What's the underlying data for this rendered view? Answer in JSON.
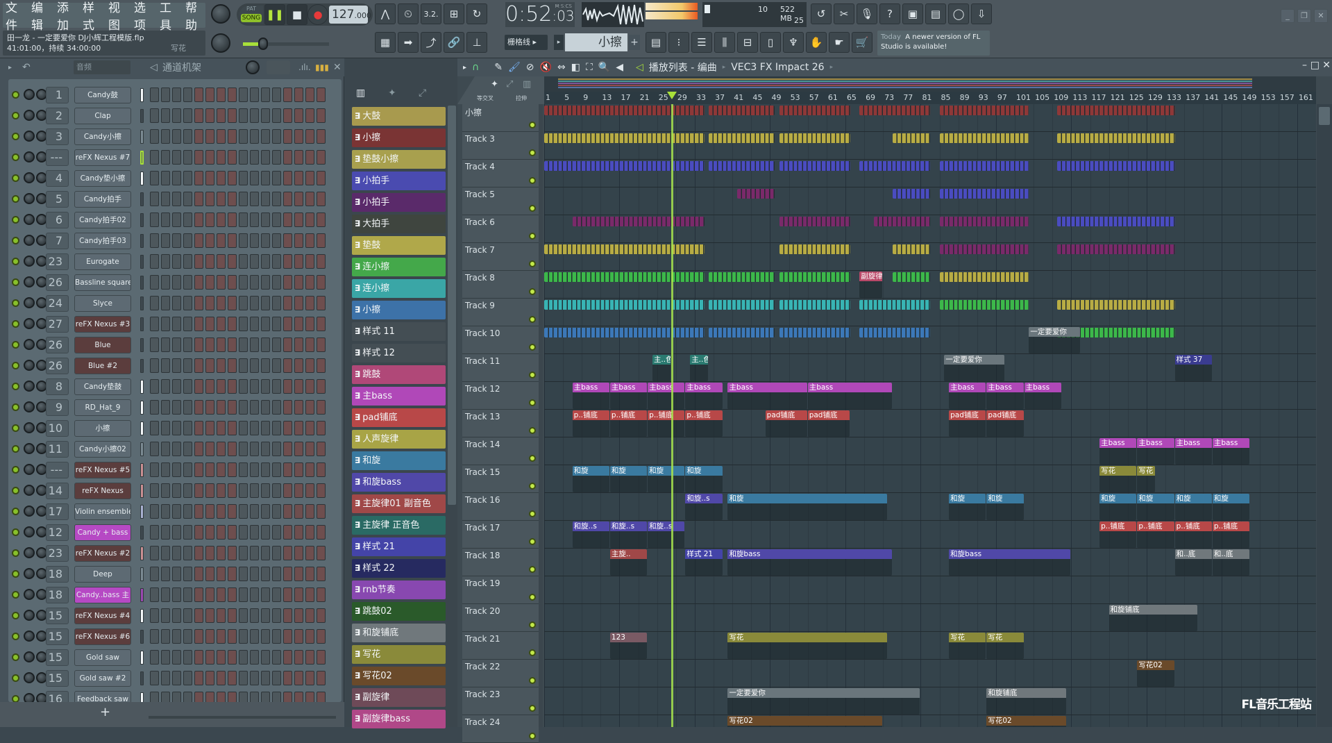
{
  "menu": [
    "文件",
    "编辑",
    "添加",
    "样式",
    "视图",
    "选项",
    "工具",
    "帮助"
  ],
  "song": {
    "file": "田一龙 - 一定要爱你 DJ小辉工程模版.flp",
    "time": "41:01:00，持续 34:00:00",
    "hint": "写花"
  },
  "transport": {
    "mode_top": "PAT",
    "mode": "SONG",
    "tempo": "127",
    "tempo_dec": ".000",
    "clock_main": "0:52",
    "clock_cs": ":03",
    "clock_unit": "M:S:CS"
  },
  "cpu": {
    "value": "10",
    "memory": "522 MB",
    "polyphony": "25"
  },
  "snap": "栅格线",
  "current_pattern": "小擦",
  "news": {
    "today": "Today",
    "text": "A newer version of FL Studio is available!"
  },
  "rack": {
    "filter": "音频",
    "title": "通道机架",
    "add": "+",
    "channels": [
      {
        "num": "1",
        "name": "Candy鼓",
        "style": "",
        "bar": "white"
      },
      {
        "num": "2",
        "name": "Clap",
        "style": "",
        "bar": ""
      },
      {
        "num": "3",
        "name": "Candy小擦",
        "style": "",
        "bar": "grey",
        "steps": [
          3,
          7,
          11,
          15
        ]
      },
      {
        "num": "---",
        "name": "reFX Nexus #7",
        "style": "",
        "bar": "green"
      },
      {
        "num": "4",
        "name": "Candy垫小擦",
        "style": "",
        "bar": "white"
      },
      {
        "num": "5",
        "name": "Candy拍手",
        "style": "",
        "bar": ""
      },
      {
        "num": "6",
        "name": "Candy拍手02",
        "style": "",
        "bar": ""
      },
      {
        "num": "7",
        "name": "Candy拍手03",
        "style": "",
        "bar": ""
      },
      {
        "num": "23",
        "name": "Eurogate",
        "style": "",
        "bar": ""
      },
      {
        "num": "26",
        "name": "Bassline square",
        "style": "",
        "bar": ""
      },
      {
        "num": "24",
        "name": "Slyce",
        "style": "",
        "bar": ""
      },
      {
        "num": "27",
        "name": "reFX Nexus #3",
        "style": "red",
        "bar": ""
      },
      {
        "num": "26",
        "name": "Blue",
        "style": "red",
        "bar": ""
      },
      {
        "num": "26",
        "name": "Blue #2",
        "style": "red",
        "bar": ""
      },
      {
        "num": "8",
        "name": "Candy垫鼓",
        "style": "",
        "bar": "white"
      },
      {
        "num": "9",
        "name": "RD_Hat_9",
        "style": "",
        "bar": "white"
      },
      {
        "num": "10",
        "name": "小擦",
        "style": "",
        "bar": "white"
      },
      {
        "num": "11",
        "name": "Candy小擦02",
        "style": "",
        "bar": "grey"
      },
      {
        "num": "---",
        "name": "reFX Nexus #5",
        "style": "red",
        "bar": "pink"
      },
      {
        "num": "14",
        "name": "reFX Nexus",
        "style": "red",
        "bar": "pink"
      },
      {
        "num": "17",
        "name": "Violin ensemble",
        "style": "",
        "bar": "lav"
      },
      {
        "num": "12",
        "name": "Candy  + bass",
        "style": "purple",
        "bar": ""
      },
      {
        "num": "23",
        "name": "reFX Nexus #2",
        "style": "red",
        "bar": "pink"
      },
      {
        "num": "18",
        "name": "Deep",
        "style": "",
        "bar": "grey"
      },
      {
        "num": "18",
        "name": "Candy..bass 主",
        "style": "purple",
        "bar": "purple"
      },
      {
        "num": "15",
        "name": "reFX Nexus #4",
        "style": "red",
        "bar": "white"
      },
      {
        "num": "15",
        "name": "reFX Nexus #6",
        "style": "red",
        "bar": ""
      },
      {
        "num": "15",
        "name": "Gold saw",
        "style": "",
        "bar": "white"
      },
      {
        "num": "15",
        "name": "Gold saw #2",
        "style": "",
        "bar": ""
      },
      {
        "num": "16",
        "name": "Feedback saw",
        "style": "",
        "bar": "white"
      }
    ]
  },
  "playlist": {
    "title": "播放列表 - 编曲",
    "crumb": "VEC3 FX Impact 26",
    "first_track": "小擦",
    "ruler": [
      "1",
      "5",
      "9",
      "13",
      "17",
      "21",
      "25",
      "29",
      "33",
      "37",
      "41",
      "45",
      "49",
      "53",
      "57",
      "61",
      "65",
      "69",
      "73",
      "77",
      "81",
      "85",
      "89",
      "93",
      "97",
      "101",
      "105",
      "109",
      "113",
      "117",
      "121",
      "125",
      "129",
      "133",
      "137",
      "141",
      "145",
      "149",
      "153",
      "157",
      "161"
    ],
    "header_labels": {
      "crossfade": "等交叉",
      "stretch": "拉伸"
    },
    "tracks": [
      "小擦",
      "Track 3",
      "Track 4",
      "Track 5",
      "Track 6",
      "Track 7",
      "Track 8",
      "Track 9",
      "Track 10",
      "Track 11",
      "Track 12",
      "Track 13",
      "Track 14",
      "Track 15",
      "Track 16",
      "Track 17",
      "Track 18",
      "Track 19",
      "Track 20",
      "Track 21",
      "Track 22",
      "Track 23",
      "Track 24"
    ],
    "patterns": [
      {
        "name": "大鼓",
        "color": "#a89a4e"
      },
      {
        "name": "小擦",
        "color": "#7a3434"
      },
      {
        "name": "垫鼓小擦",
        "color": "#a8a04e"
      },
      {
        "name": "小拍手",
        "color": "#4a4bb0"
      },
      {
        "name": "小拍手",
        "color": "#5a2a6a"
      },
      {
        "name": "大拍手",
        "color": "#3f453f"
      },
      {
        "name": "垫鼓",
        "color": "#b0a84a"
      },
      {
        "name": "连小擦",
        "color": "#44a84a"
      },
      {
        "name": "连小擦",
        "color": "#3aa6a6"
      },
      {
        "name": "小擦",
        "color": "#3d72a8"
      },
      {
        "name": "样式 11",
        "color": "#444e54"
      },
      {
        "name": "样式 12",
        "color": "#444e54"
      },
      {
        "name": "跳鼓",
        "color": "#b04878"
      },
      {
        "name": "主bass",
        "color": "#b048b8"
      },
      {
        "name": "pad铺底",
        "color": "#b84848"
      },
      {
        "name": "人声旋律",
        "color": "#a8a446"
      },
      {
        "name": "和旋",
        "color": "#3a7aa0"
      },
      {
        "name": "和旋bass",
        "color": "#5048a8"
      },
      {
        "name": "主旋律01  副音色",
        "color": "#a04848"
      },
      {
        "name": "主旋律 正音色",
        "color": "#2a6a64"
      },
      {
        "name": "样式 21",
        "color": "#4444a8"
      },
      {
        "name": "样式 22",
        "color": "#262a60"
      },
      {
        "name": "rnb节奏",
        "color": "#8848b0"
      },
      {
        "name": "跳鼓02",
        "color": "#2a5a2a"
      },
      {
        "name": "和旋铺底",
        "color": "#70787c"
      },
      {
        "name": "写花",
        "color": "#8a8a3a"
      },
      {
        "name": "写花02",
        "color": "#6a4a2a"
      },
      {
        "name": "副旋律",
        "color": "#6e4a58"
      },
      {
        "name": "副旋律bass",
        "color": "#b04888"
      }
    ],
    "lanes": [
      {
        "blocks": [
          [
            0,
            34,
            "#8e3838"
          ],
          [
            35,
            49,
            "#8e3838"
          ],
          [
            50,
            65,
            "#8e3838"
          ],
          [
            67,
            82,
            "#8e3838"
          ],
          [
            84,
            103,
            "#8e3838"
          ],
          [
            109,
            134,
            "#8e3838"
          ]
        ]
      },
      {
        "blocks": [
          [
            0,
            34,
            "#b8ac44"
          ],
          [
            35,
            49,
            "#b8ac44"
          ],
          [
            50,
            65,
            "#b8ac44"
          ],
          [
            74,
            82,
            "#b8ac44"
          ],
          [
            84,
            103,
            "#b8ac44"
          ],
          [
            109,
            134,
            "#b8ac44"
          ]
        ]
      },
      {
        "blocks": [
          [
            0,
            34,
            "#4a4cc0"
          ],
          [
            35,
            49,
            "#4a4cc0"
          ],
          [
            50,
            65,
            "#4a4cc0"
          ],
          [
            67,
            82,
            "#4a4cc0"
          ],
          [
            84,
            103,
            "#4a4cc0"
          ],
          [
            109,
            134,
            "#4a4cc0"
          ]
        ]
      },
      {
        "blocks": [
          [
            41,
            49,
            "#7a2a6a"
          ],
          [
            74,
            82,
            "#4a4cc0"
          ],
          [
            84,
            103,
            "#4a4cc0"
          ]
        ]
      },
      {
        "blocks": [
          [
            6,
            34,
            "#7a2a6a"
          ],
          [
            50,
            65,
            "#7a2a6a"
          ],
          [
            70,
            82,
            "#7a2a6a"
          ],
          [
            84,
            103,
            "#7a2a6a"
          ],
          [
            109,
            134,
            "#4a4cc0"
          ]
        ]
      },
      {
        "blocks": [
          [
            0,
            34,
            "#b8ac44"
          ],
          [
            50,
            65,
            "#b8ac44"
          ],
          [
            74,
            82,
            "#b8ac44"
          ],
          [
            84,
            103,
            "#7a2a6a"
          ],
          [
            109,
            134,
            "#7a2a6a"
          ]
        ]
      },
      {
        "blocks": [
          [
            0,
            34,
            "#3cb84a"
          ],
          [
            35,
            49,
            "#3cb84a"
          ],
          [
            50,
            65,
            "#3cb84a"
          ],
          [
            74,
            82,
            "#3cb84a"
          ],
          [
            84,
            103,
            "#b8ac44"
          ]
        ]
      },
      {
        "blocks": [
          [
            0,
            34,
            "#38b4b4"
          ],
          [
            35,
            49,
            "#38b4b4"
          ],
          [
            50,
            65,
            "#38b4b4"
          ],
          [
            67,
            82,
            "#38b4b4"
          ],
          [
            84,
            103,
            "#3cb84a"
          ],
          [
            109,
            134,
            "#b8ac44"
          ]
        ]
      },
      {
        "blocks": [
          [
            0,
            34,
            "#3c78b8"
          ],
          [
            35,
            49,
            "#3c78b8"
          ],
          [
            50,
            65,
            "#3c78b8"
          ],
          [
            67,
            82,
            "#3c78b8"
          ],
          [
            109,
            134,
            "#3cb84a"
          ]
        ]
      }
    ],
    "clips": [
      {
        "lane": 6,
        "start": 67,
        "len": 5,
        "label": "副旋律",
        "color": "#b84868"
      },
      {
        "lane": 9,
        "start": 23,
        "len": 4,
        "label": "主..色",
        "color": "#2a7a70"
      },
      {
        "lane": 9,
        "start": 31,
        "len": 4,
        "label": "主..色",
        "color": "#2a7a70"
      },
      {
        "lane": 9,
        "start": 85,
        "len": 13,
        "label": "一定要爱你",
        "color": "#6a767c"
      },
      {
        "lane": 8,
        "start": 103,
        "len": 11,
        "label": "一定要爱你",
        "color": "#6a767c"
      },
      {
        "lane": 9,
        "start": 134,
        "len": 8,
        "label": "样式 37",
        "color": "#3a3c90"
      },
      {
        "lane": 10,
        "start": 6,
        "len": 8,
        "label": "主bass",
        "color": "#b048b8"
      },
      {
        "lane": 10,
        "start": 14,
        "len": 8,
        "label": "主bass",
        "color": "#b048b8"
      },
      {
        "lane": 10,
        "start": 22,
        "len": 8,
        "label": "主bass",
        "color": "#b048b8"
      },
      {
        "lane": 10,
        "start": 30,
        "len": 8,
        "label": "主bass",
        "color": "#b048b8"
      },
      {
        "lane": 10,
        "start": 39,
        "len": 17,
        "label": "主bass",
        "color": "#b048b8"
      },
      {
        "lane": 10,
        "start": 56,
        "len": 18,
        "label": "主bass",
        "color": "#b048b8"
      },
      {
        "lane": 10,
        "start": 86,
        "len": 8,
        "label": "主bass",
        "color": "#b048b8"
      },
      {
        "lane": 10,
        "start": 94,
        "len": 8,
        "label": "主bass",
        "color": "#b048b8"
      },
      {
        "lane": 10,
        "start": 102,
        "len": 8,
        "label": "主bass",
        "color": "#b048b8"
      },
      {
        "lane": 11,
        "start": 6,
        "len": 8,
        "label": "p..铺底",
        "color": "#b84848"
      },
      {
        "lane": 11,
        "start": 14,
        "len": 8,
        "label": "p..铺底",
        "color": "#b84848"
      },
      {
        "lane": 11,
        "start": 22,
        "len": 8,
        "label": "p..铺底",
        "color": "#b84848"
      },
      {
        "lane": 11,
        "start": 30,
        "len": 8,
        "label": "p..铺底",
        "color": "#b84848"
      },
      {
        "lane": 11,
        "start": 47,
        "len": 9,
        "label": "pad铺底",
        "color": "#b84848"
      },
      {
        "lane": 11,
        "start": 56,
        "len": 9,
        "label": "pad铺底",
        "color": "#b84848"
      },
      {
        "lane": 11,
        "start": 86,
        "len": 8,
        "label": "pad铺底",
        "color": "#b84848"
      },
      {
        "lane": 11,
        "start": 94,
        "len": 8,
        "label": "pad铺底",
        "color": "#b84848"
      },
      {
        "lane": 12,
        "start": 118,
        "len": 8,
        "label": "主bass",
        "color": "#b048b8"
      },
      {
        "lane": 12,
        "start": 126,
        "len": 8,
        "label": "主bass",
        "color": "#b048b8"
      },
      {
        "lane": 12,
        "start": 134,
        "len": 8,
        "label": "主bass",
        "color": "#b048b8"
      },
      {
        "lane": 12,
        "start": 142,
        "len": 8,
        "label": "主bass",
        "color": "#b048b8"
      },
      {
        "lane": 13,
        "start": 6,
        "len": 8,
        "label": "和旋",
        "color": "#3a7aa0"
      },
      {
        "lane": 13,
        "start": 14,
        "len": 8,
        "label": "和旋",
        "color": "#3a7aa0"
      },
      {
        "lane": 13,
        "start": 22,
        "len": 8,
        "label": "和旋",
        "color": "#3a7aa0"
      },
      {
        "lane": 13,
        "start": 30,
        "len": 8,
        "label": "和旋",
        "color": "#3a7aa0"
      },
      {
        "lane": 13,
        "start": 118,
        "len": 8,
        "label": "写花",
        "color": "#8a8a3a"
      },
      {
        "lane": 13,
        "start": 126,
        "len": 4,
        "label": "写花",
        "color": "#8a8a3a"
      },
      {
        "lane": 14,
        "start": 30,
        "len": 8,
        "label": "和旋..s",
        "color": "#5048a8"
      },
      {
        "lane": 14,
        "start": 39,
        "len": 34,
        "label": "和旋",
        "color": "#3a7aa0"
      },
      {
        "lane": 14,
        "start": 86,
        "len": 8,
        "label": "和旋",
        "color": "#3a7aa0"
      },
      {
        "lane": 14,
        "start": 94,
        "len": 8,
        "label": "和旋",
        "color": "#3a7aa0"
      },
      {
        "lane": 14,
        "start": 118,
        "len": 8,
        "label": "和旋",
        "color": "#3a7aa0"
      },
      {
        "lane": 14,
        "start": 126,
        "len": 8,
        "label": "和旋",
        "color": "#3a7aa0"
      },
      {
        "lane": 14,
        "start": 134,
        "len": 8,
        "label": "和旋",
        "color": "#3a7aa0"
      },
      {
        "lane": 14,
        "start": 142,
        "len": 8,
        "label": "和旋",
        "color": "#3a7aa0"
      },
      {
        "lane": 15,
        "start": 6,
        "len": 8,
        "label": "和旋..s",
        "color": "#5048a8"
      },
      {
        "lane": 15,
        "start": 14,
        "len": 8,
        "label": "和旋..s",
        "color": "#5048a8"
      },
      {
        "lane": 15,
        "start": 22,
        "len": 8,
        "label": "和旋..s",
        "color": "#5048a8"
      },
      {
        "lane": 15,
        "start": 118,
        "len": 8,
        "label": "p..铺底",
        "color": "#b84848"
      },
      {
        "lane": 15,
        "start": 126,
        "len": 8,
        "label": "p..铺底",
        "color": "#b84848"
      },
      {
        "lane": 15,
        "start": 134,
        "len": 8,
        "label": "p..铺底",
        "color": "#b84848"
      },
      {
        "lane": 15,
        "start": 142,
        "len": 8,
        "label": "p..铺底",
        "color": "#b84848"
      },
      {
        "lane": 16,
        "start": 14,
        "len": 8,
        "label": "主旋..",
        "color": "#a04848"
      },
      {
        "lane": 16,
        "start": 30,
        "len": 8,
        "label": "样式 21",
        "color": "#4444a8"
      },
      {
        "lane": 16,
        "start": 39,
        "len": 35,
        "label": "和旋bass",
        "color": "#5048a8"
      },
      {
        "lane": 16,
        "start": 86,
        "len": 26,
        "label": "和旋bass",
        "color": "#5048a8"
      },
      {
        "lane": 16,
        "start": 134,
        "len": 8,
        "label": "和..底",
        "color": "#70787c"
      },
      {
        "lane": 16,
        "start": 142,
        "len": 8,
        "label": "和..底",
        "color": "#70787c"
      },
      {
        "lane": 18,
        "start": 120,
        "len": 19,
        "label": "和旋铺底",
        "color": "#70787c"
      },
      {
        "lane": 19,
        "start": 14,
        "len": 8,
        "label": "123",
        "color": "#7a5a64"
      },
      {
        "lane": 19,
        "start": 39,
        "len": 34,
        "label": "写花",
        "color": "#8a8a3a"
      },
      {
        "lane": 19,
        "start": 86,
        "len": 8,
        "label": "写花",
        "color": "#8a8a3a"
      },
      {
        "lane": 19,
        "start": 94,
        "len": 8,
        "label": "写花",
        "color": "#8a8a3a"
      },
      {
        "lane": 20,
        "start": 126,
        "len": 8,
        "label": "写花02",
        "color": "#6a4a2a"
      },
      {
        "lane": 21,
        "start": 39,
        "len": 41,
        "label": "一定要爱你",
        "color": "#6a767c"
      },
      {
        "lane": 21,
        "start": 94,
        "len": 17,
        "label": "和旋铺底",
        "color": "#70787c"
      },
      {
        "lane": 22,
        "start": 39,
        "len": 33,
        "label": "写花02",
        "color": "#6a4a2a"
      },
      {
        "lane": 22,
        "start": 94,
        "len": 17,
        "label": "写花02",
        "color": "#6a4a2a"
      }
    ],
    "playhead_bar": 28
  },
  "watermark": "FL音乐工程站"
}
